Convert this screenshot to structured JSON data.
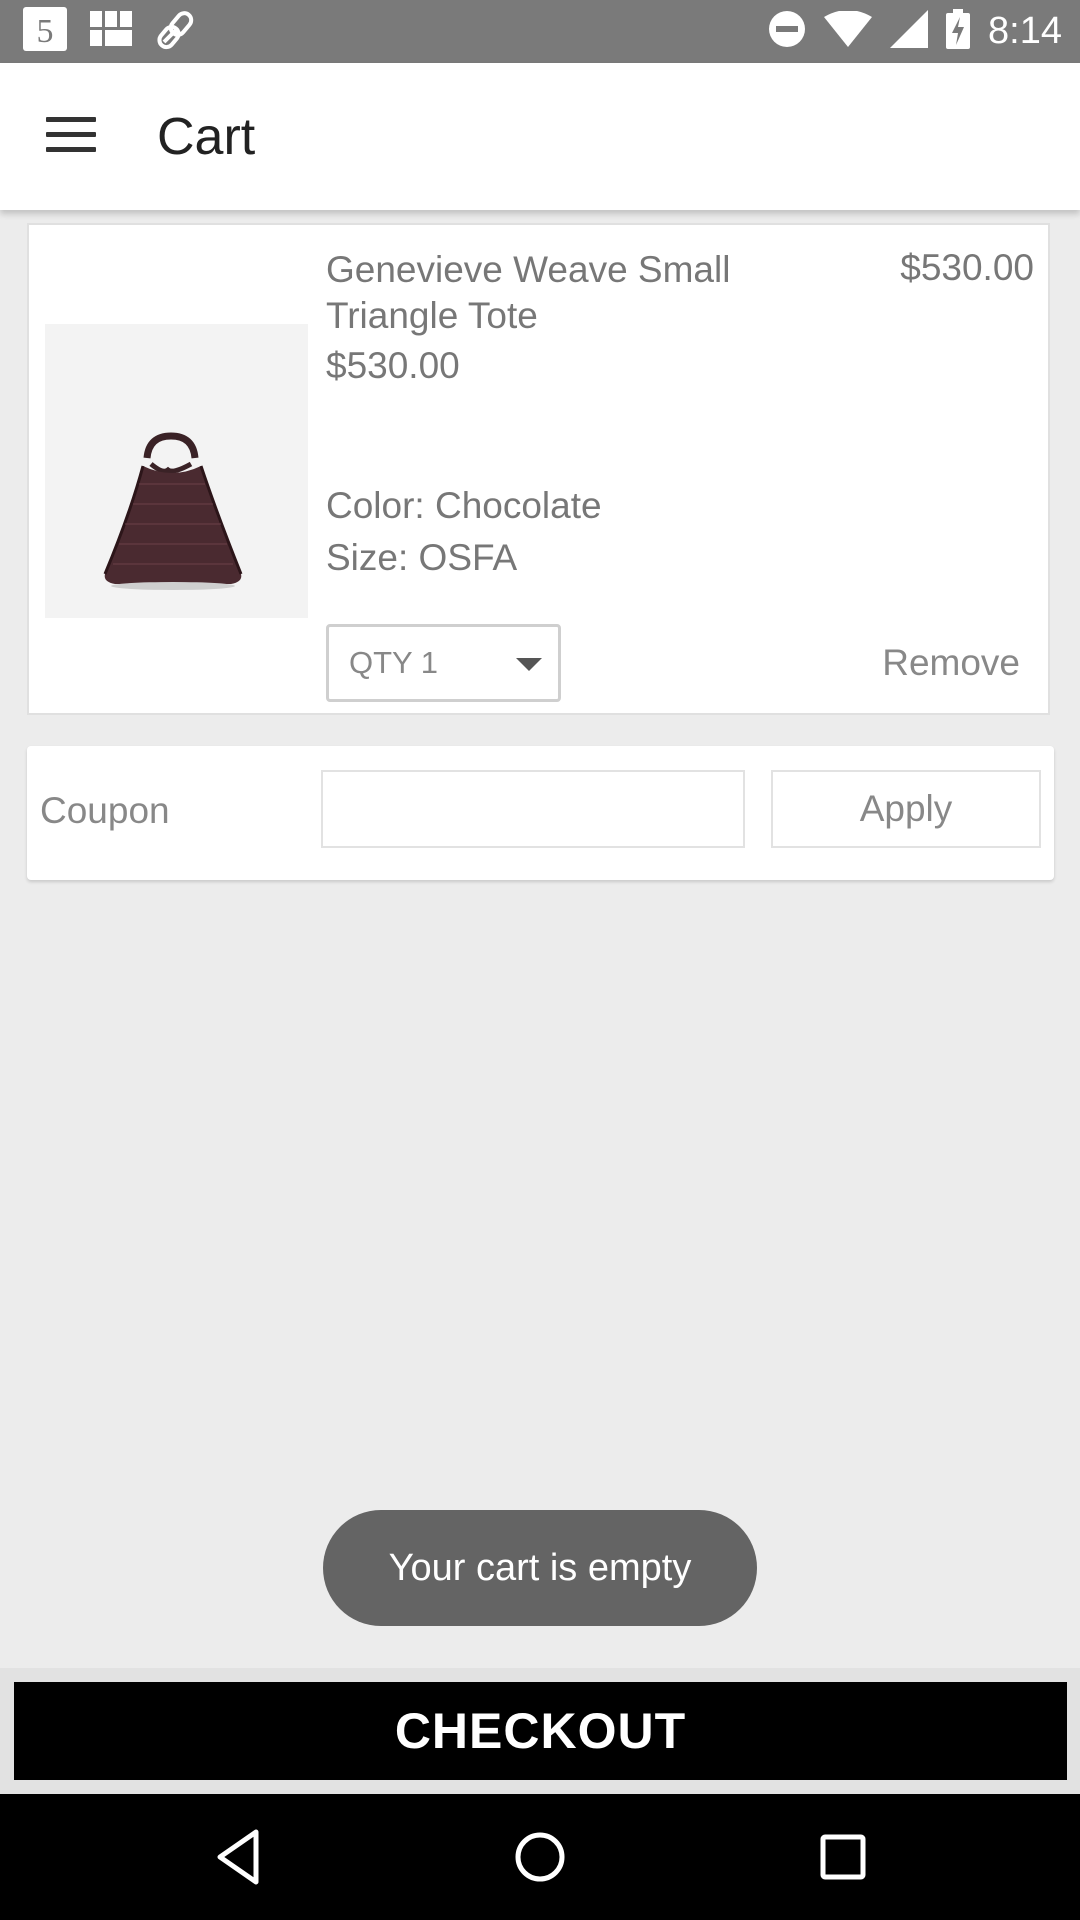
{
  "status_bar": {
    "time": "8:14",
    "icons": [
      "sim-5-icon",
      "grid-app-icon",
      "link-icon",
      "do-not-disturb-icon",
      "wifi-icon",
      "cell-signal-icon",
      "battery-charging-icon"
    ]
  },
  "app_bar": {
    "title": "Cart",
    "menu_icon": "hamburger-menu-icon"
  },
  "cart": {
    "items": [
      {
        "name": "Genevieve Weave Small Triangle Tote",
        "unit_price": "$530.00",
        "total_price": "$530.00",
        "color": "Color: Chocolate",
        "size": "Size: OSFA",
        "qty_label": "QTY 1",
        "remove_label": "Remove",
        "image": "brown-woven-handbag"
      }
    ]
  },
  "coupon": {
    "label": "Coupon",
    "input_value": "",
    "apply_label": "Apply"
  },
  "toast": {
    "message": "Your cart is empty"
  },
  "checkout": {
    "label": "CHECKOUT"
  },
  "nav_bar": {
    "icons": [
      "back-triangle-icon",
      "home-circle-icon",
      "recents-square-icon"
    ]
  },
  "colors": {
    "status_bar": "#7a7a7a",
    "background": "#ececec",
    "checkout_button": "#000000",
    "toast": "#646464"
  }
}
